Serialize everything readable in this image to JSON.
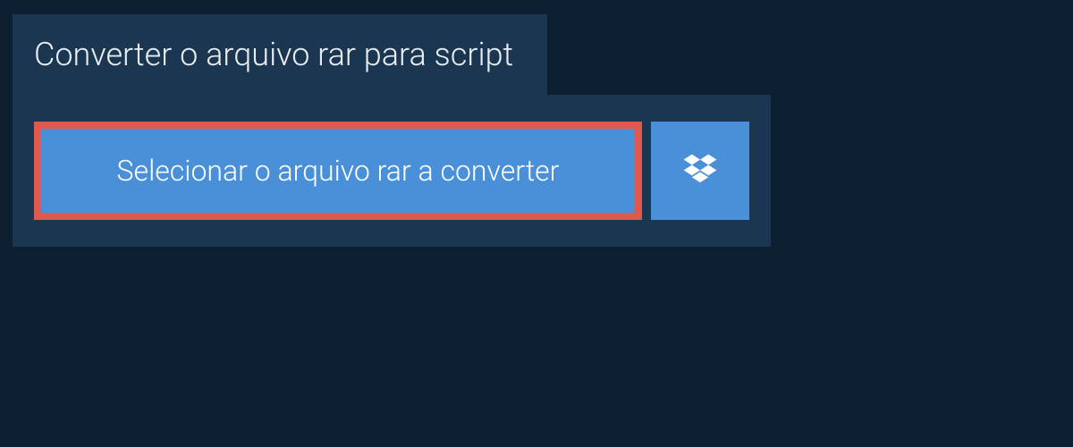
{
  "header": {
    "title": "Converter o arquivo rar para script"
  },
  "actions": {
    "select_file_label": "Selecionar o arquivo rar a converter"
  },
  "colors": {
    "page_bg": "#0c2031",
    "panel_bg": "#1b3651",
    "button_bg": "#4a90d9",
    "highlight_border": "#e0594f",
    "text_light": "#ffffff"
  },
  "icons": {
    "dropbox": "dropbox-icon"
  }
}
